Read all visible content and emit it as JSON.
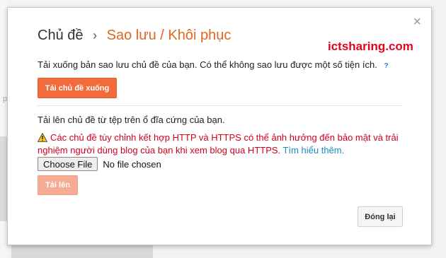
{
  "background": {
    "side_text": "p"
  },
  "dialog": {
    "close_glyph": "×",
    "breadcrumb": {
      "parent": "Chủ đề",
      "separator": "›",
      "current": "Sao lưu / Khôi phục"
    },
    "watermark": "ictsharing.com",
    "download": {
      "description": "Tải xuống bản sao lưu chủ đề của bạn. Có thể không sao lưu được một số tiện ích.",
      "help_label": "?",
      "button_label": "Tải chủ đề xuống"
    },
    "upload": {
      "description": "Tải lên chủ đề từ tệp trên ổ đĩa cứng của bạn.",
      "warning_text": "Các chủ đề tùy chỉnh kết hợp HTTP và HTTPS có thể ảnh hưởng đến bảo mật và trải nghiệm người dùng blog của bạn khi xem blog qua HTTPS.",
      "learn_more": "Tìm hiểu thêm.",
      "choose_file_label": "Choose File",
      "file_status": "No file chosen",
      "button_label": "Tải lên"
    },
    "close_button_label": "Đóng lại"
  },
  "colors": {
    "accent_orange": "#e2661e",
    "primary_button": "#f26b3a",
    "disabled_button": "#f6ab94",
    "warning_red": "#d3001d",
    "link_blue": "#1a8bbd"
  }
}
